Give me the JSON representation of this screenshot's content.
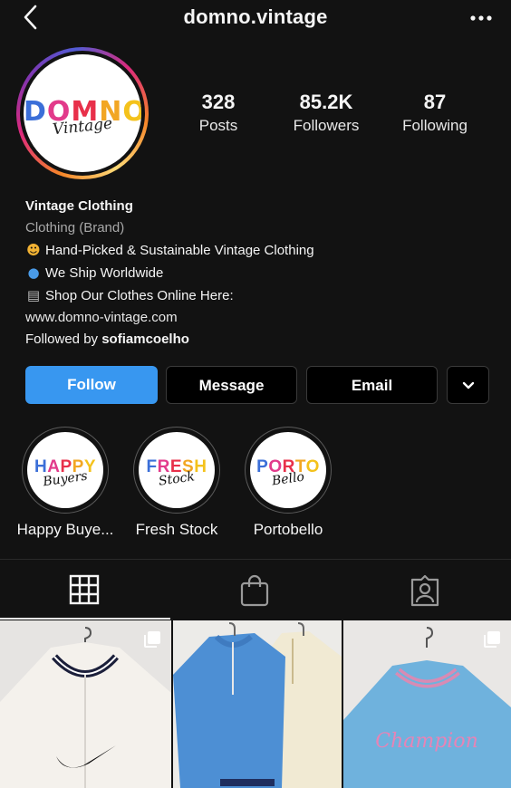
{
  "header": {
    "title": "domno.vintage"
  },
  "profile": {
    "logo_main": "DOMNO",
    "logo_script": "Vintage",
    "stats": [
      {
        "num": "328",
        "label": "Posts"
      },
      {
        "num": "85.2K",
        "label": "Followers"
      },
      {
        "num": "87",
        "label": "Following"
      }
    ]
  },
  "bio": {
    "name": "Vintage Clothing",
    "category": "Clothing (Brand)",
    "line1": "Hand-Picked & Sustainable Vintage Clothing",
    "line2": "We Ship Worldwide",
    "line3": "Shop Our Clothes Online Here:",
    "link": "www.domno-vintage.com",
    "followed_prefix": "Followed by ",
    "followed_user": "sofiamcoelho"
  },
  "buttons": {
    "follow": "Follow",
    "message": "Message",
    "email": "Email"
  },
  "highlights": [
    {
      "label": "Happy Buye...",
      "art_main": "HAPPY",
      "art_script": "Buyers"
    },
    {
      "label": "Fresh Stock",
      "art_main": "FRESH",
      "art_script": "Stock"
    },
    {
      "label": "Portobello",
      "art_main": "PORTO",
      "art_script": "Bello"
    }
  ],
  "tabs": [
    {
      "icon": "grid-icon",
      "active": true
    },
    {
      "icon": "shopping-bag-icon",
      "active": false
    },
    {
      "icon": "tagged-user-icon",
      "active": false
    }
  ],
  "posts": [
    {
      "icon": "multiple-photos-icon",
      "description_icon": "white-nike-jacket"
    },
    {
      "icon": "none",
      "description_icon": "blue-and-cream-nike-pullovers"
    },
    {
      "icon": "multiple-photos-icon",
      "description_icon": "blue-champion-sweater"
    }
  ],
  "colors": {
    "accent": "#3897f0",
    "background": "#121212"
  }
}
